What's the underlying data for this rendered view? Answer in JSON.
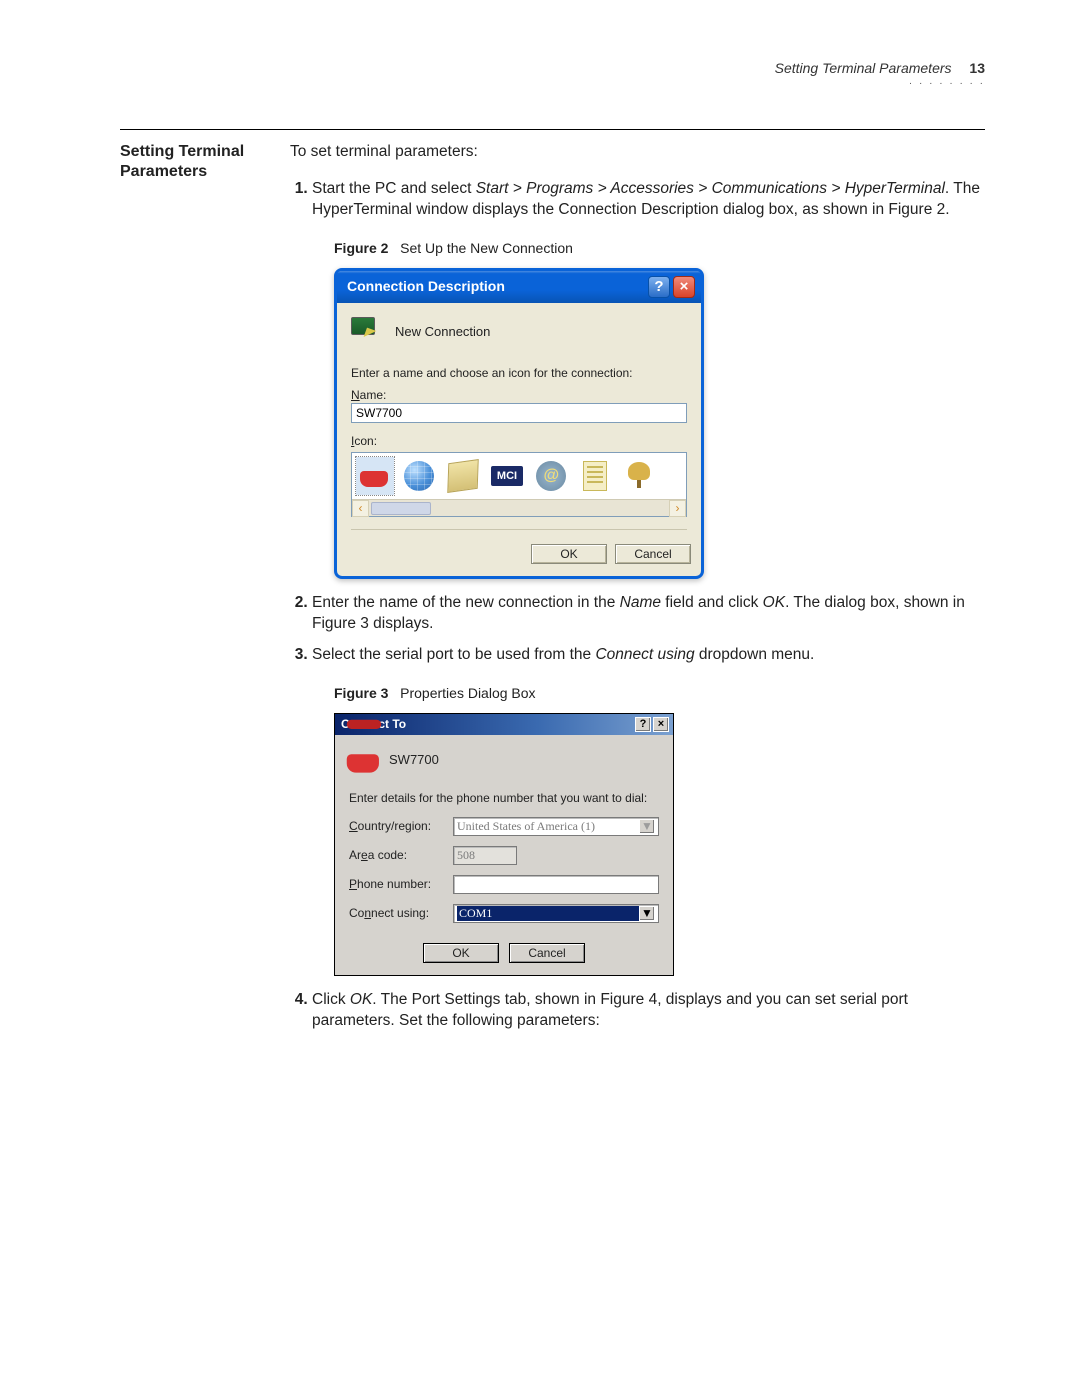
{
  "header": {
    "running_title": "Setting Terminal Parameters",
    "page_number": "13"
  },
  "section_heading": "Setting Terminal Parameters",
  "intro": "To set terminal parameters:",
  "steps": {
    "s1_a": "Start the PC and select ",
    "s1_b": "Start > Programs > Accessories > Communications > HyperTerminal",
    "s1_c": ". The HyperTerminal window displays the Connection Description dialog box, as shown in Figure 2.",
    "s2_a": "Enter the name of the new connection in the ",
    "s2_b": "Name",
    "s2_c": " field and click ",
    "s2_d": "OK",
    "s2_e": ". The dialog box, shown in Figure 3 displays.",
    "s3_a": "Select the serial port to be used from the ",
    "s3_b": "Connect using",
    "s3_c": " dropdown menu.",
    "s4_a": "Click ",
    "s4_b": "OK",
    "s4_c": ". The Port Settings tab, shown in Figure 4, displays and you can set serial port parameters. Set the following parameters:"
  },
  "figure2": {
    "label": "Figure 2",
    "caption": "Set Up the New Connection",
    "dialog": {
      "title": "Connection Description",
      "help_btn": "?",
      "close_btn": "×",
      "subtitle": "New Connection",
      "instruction": "Enter a name and choose an icon for the connection:",
      "name_label": "Name:",
      "name_value": "SW7700",
      "icon_label": "Icon:",
      "mci_text": "MCI",
      "at_text": "@",
      "scroll_left": "‹",
      "scroll_right": "›",
      "ok": "OK",
      "cancel": "Cancel"
    }
  },
  "figure3": {
    "label": "Figure 3",
    "caption": "Properties Dialog Box",
    "dialog": {
      "title": "Connect To",
      "help_btn": "?",
      "close_btn": "×",
      "conn_name": "SW7700",
      "instruction": "Enter details for the phone number that you want to dial:",
      "country_label": "Country/region:",
      "country_value": "United States of America (1)",
      "area_label": "Area code:",
      "area_value": "508",
      "phone_label": "Phone number:",
      "phone_value": "",
      "connect_label": "Connect using:",
      "connect_value": "COM1",
      "ok": "OK",
      "cancel": "Cancel",
      "dropdown_arrow": "▼"
    }
  }
}
